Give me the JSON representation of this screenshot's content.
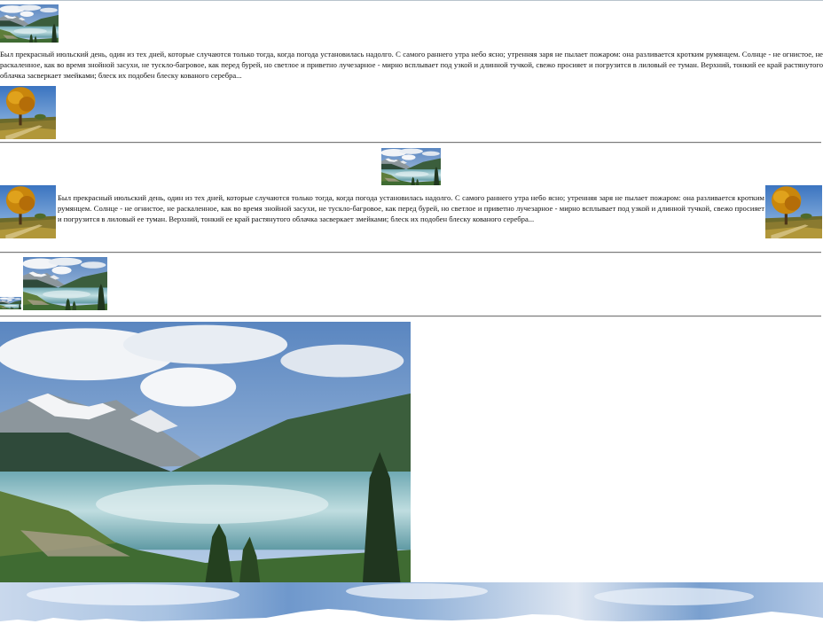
{
  "article": {
    "paragraph": "Был прекрасный июльский день, один из тех дней, которые случаются только тогда, когда погода установилась надолго. С самого раннего утра небо ясно; утренняя заря не пылает пожаром: она разливается кротким румянцем. Солнце - не огнистое, не раскаленное, как во время знойной засухи, не тускло-багровое, как перед бурей, но светлое и приветно лучезарное - мирно всплывает под узкой и длинной тучкой, свежо просияет и погрузится в лиловый ее туман. Верхний, тонкий ее край растянутого облачка засверкает змейками; блеск их подобен блеску кованого серебра..."
  },
  "images": {
    "lake": "mountain-lake-photo",
    "autumn": "autumn-tree-photo",
    "mountain_banner": "snowy-mountain-banner-photo"
  }
}
